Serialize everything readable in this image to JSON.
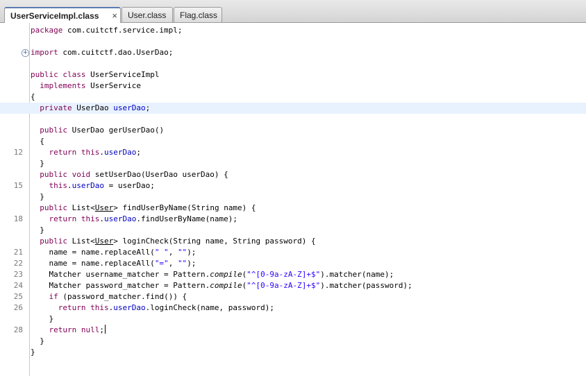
{
  "tabs": [
    {
      "label": "UserServiceImpl.class",
      "active": true,
      "close": "×"
    },
    {
      "label": "User.class",
      "active": false
    },
    {
      "label": "Flag.class",
      "active": false
    }
  ],
  "colors": {
    "keyword": "#7f0055",
    "field": "#0000c0",
    "string": "#2a00ff",
    "highlight": "#e8f2fe"
  },
  "lines": [
    {
      "n": "",
      "seg": [
        [
          "k",
          "package"
        ],
        [
          "t",
          " com.cuitctf.service.impl;"
        ]
      ]
    },
    {
      "n": "",
      "seg": []
    },
    {
      "n": "",
      "fold": "+",
      "seg": [
        [
          "k",
          "import"
        ],
        [
          "t",
          " com.cuitctf.dao.UserDao;"
        ]
      ]
    },
    {
      "n": "",
      "seg": []
    },
    {
      "n": "",
      "seg": [
        [
          "k",
          "public class"
        ],
        [
          "t",
          " UserServiceImpl"
        ]
      ]
    },
    {
      "n": "",
      "seg": [
        [
          "t",
          "  "
        ],
        [
          "k",
          "implements"
        ],
        [
          "t",
          " UserService"
        ]
      ]
    },
    {
      "n": "",
      "seg": [
        [
          "t",
          "{"
        ]
      ]
    },
    {
      "n": "",
      "hl": true,
      "seg": [
        [
          "t",
          "  "
        ],
        [
          "k",
          "private"
        ],
        [
          "t",
          " UserDao "
        ],
        [
          "f",
          "userDao"
        ],
        [
          "t",
          ";"
        ]
      ]
    },
    {
      "n": "",
      "seg": []
    },
    {
      "n": "",
      "seg": [
        [
          "t",
          "  "
        ],
        [
          "k",
          "public"
        ],
        [
          "t",
          " UserDao gerUserDao()"
        ]
      ]
    },
    {
      "n": "",
      "seg": [
        [
          "t",
          "  {"
        ]
      ]
    },
    {
      "n": "12",
      "seg": [
        [
          "t",
          "    "
        ],
        [
          "k",
          "return this"
        ],
        [
          "t",
          "."
        ],
        [
          "f",
          "userDao"
        ],
        [
          "t",
          ";"
        ]
      ]
    },
    {
      "n": "",
      "seg": [
        [
          "t",
          "  }"
        ]
      ]
    },
    {
      "n": "",
      "seg": [
        [
          "t",
          "  "
        ],
        [
          "k",
          "public void"
        ],
        [
          "t",
          " setUserDao(UserDao userDao) {"
        ]
      ]
    },
    {
      "n": "15",
      "seg": [
        [
          "t",
          "    "
        ],
        [
          "k",
          "this"
        ],
        [
          "t",
          "."
        ],
        [
          "f",
          "userDao"
        ],
        [
          "t",
          " = userDao;"
        ]
      ]
    },
    {
      "n": "",
      "seg": [
        [
          "t",
          "  }"
        ]
      ]
    },
    {
      "n": "",
      "seg": [
        [
          "t",
          "  "
        ],
        [
          "k",
          "public"
        ],
        [
          "t",
          " List<"
        ],
        [
          "u",
          "User"
        ],
        [
          "t",
          "> findUserByName(String name) {"
        ]
      ]
    },
    {
      "n": "18",
      "seg": [
        [
          "t",
          "    "
        ],
        [
          "k",
          "return this"
        ],
        [
          "t",
          "."
        ],
        [
          "f",
          "userDao"
        ],
        [
          "t",
          ".findUserByName(name);"
        ]
      ]
    },
    {
      "n": "",
      "seg": [
        [
          "t",
          "  }"
        ]
      ]
    },
    {
      "n": "",
      "seg": [
        [
          "t",
          "  "
        ],
        [
          "k",
          "public"
        ],
        [
          "t",
          " List<"
        ],
        [
          "u",
          "User"
        ],
        [
          "t",
          "> loginCheck(String name, String password) {"
        ]
      ]
    },
    {
      "n": "21",
      "seg": [
        [
          "t",
          "    name = name.replaceAll("
        ],
        [
          "s",
          "\" \""
        ],
        [
          "t",
          ", "
        ],
        [
          "s",
          "\"\""
        ],
        [
          "t",
          ");"
        ]
      ]
    },
    {
      "n": "22",
      "seg": [
        [
          "t",
          "    name = name.replaceAll("
        ],
        [
          "s",
          "\"=\""
        ],
        [
          "t",
          ", "
        ],
        [
          "s",
          "\"\""
        ],
        [
          "t",
          ");"
        ]
      ]
    },
    {
      "n": "23",
      "seg": [
        [
          "t",
          "    Matcher username_matcher = Pattern."
        ],
        [
          "i",
          "compile"
        ],
        [
          "t",
          "("
        ],
        [
          "s",
          "\"^[0-9a-zA-Z]+$\""
        ],
        [
          "t",
          ").matcher(name);"
        ]
      ]
    },
    {
      "n": "24",
      "seg": [
        [
          "t",
          "    Matcher password_matcher = Pattern."
        ],
        [
          "i",
          "compile"
        ],
        [
          "t",
          "("
        ],
        [
          "s",
          "\"^[0-9a-zA-Z]+$\""
        ],
        [
          "t",
          ").matcher(password);"
        ]
      ]
    },
    {
      "n": "25",
      "seg": [
        [
          "t",
          "    "
        ],
        [
          "k",
          "if"
        ],
        [
          "t",
          " (password_matcher.find()) {"
        ]
      ]
    },
    {
      "n": "26",
      "seg": [
        [
          "t",
          "      "
        ],
        [
          "k",
          "return this"
        ],
        [
          "t",
          "."
        ],
        [
          "f",
          "userDao"
        ],
        [
          "t",
          ".loginCheck(name, password);"
        ]
      ]
    },
    {
      "n": "",
      "seg": [
        [
          "t",
          "    }"
        ]
      ]
    },
    {
      "n": "28",
      "caret": true,
      "seg": [
        [
          "t",
          "    "
        ],
        [
          "k",
          "return null"
        ],
        [
          "t",
          ";"
        ]
      ]
    },
    {
      "n": "",
      "seg": [
        [
          "t",
          "  }"
        ]
      ]
    },
    {
      "n": "",
      "seg": [
        [
          "t",
          "}"
        ]
      ]
    }
  ]
}
